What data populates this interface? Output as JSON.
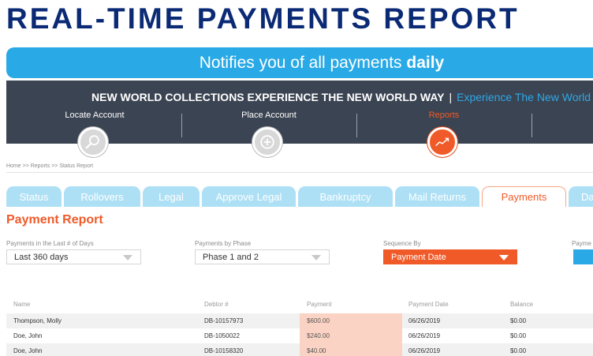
{
  "title": "REAL-TIME PAYMENTS REPORT",
  "banner": {
    "text": "Notifies you of all payments ",
    "emphasis": "daily"
  },
  "navband": {
    "tagline": "NEW WORLD COLLECTIONS EXPERIENCE THE NEW WORLD WAY",
    "separator": "|",
    "link": "Experience The New World",
    "items": [
      {
        "label": "Locate Account",
        "icon": "search-icon"
      },
      {
        "label": "Place Account",
        "icon": "plus-circle-icon"
      },
      {
        "label": "Reports",
        "icon": "trend-chart-icon"
      }
    ]
  },
  "breadcrumb": "Home  >>  Reports >>  Status Report",
  "tabs": [
    "Status",
    "Rollovers",
    "Legal",
    "Approve Legal",
    "Bankruptcy",
    "Mail Returns",
    "Payments",
    "Da"
  ],
  "active_tab": "Payments",
  "report_title": "Payment Report",
  "filters": [
    {
      "label": "Payments in the Last # of Days",
      "value": "Last 360 days"
    },
    {
      "label": "Payments by Phase",
      "value": "Phase 1 and 2"
    },
    {
      "label": "Sequence By",
      "value": "Payment Date"
    },
    {
      "label": "Payme"
    }
  ],
  "table": {
    "columns": [
      "Name",
      "Debtor #",
      "Payment",
      "Payment Date",
      "Balance"
    ],
    "rows": [
      [
        "Thompson, Molly",
        "DB-10157973",
        "$600.00",
        "06/26/2019",
        "$0.00"
      ],
      [
        "Doe, John",
        "DB-1050022",
        "$240.00",
        "06/26/2019",
        "$0.00"
      ],
      [
        "Doe, John",
        "DB-10158320",
        "$40.00",
        "06/26/2019",
        "$0.00"
      ]
    ]
  },
  "colors": {
    "brand_navy": "#0b2a75",
    "accent_orange": "#f05a28",
    "accent_blue": "#29aae6",
    "band_dark": "#3b4452"
  }
}
